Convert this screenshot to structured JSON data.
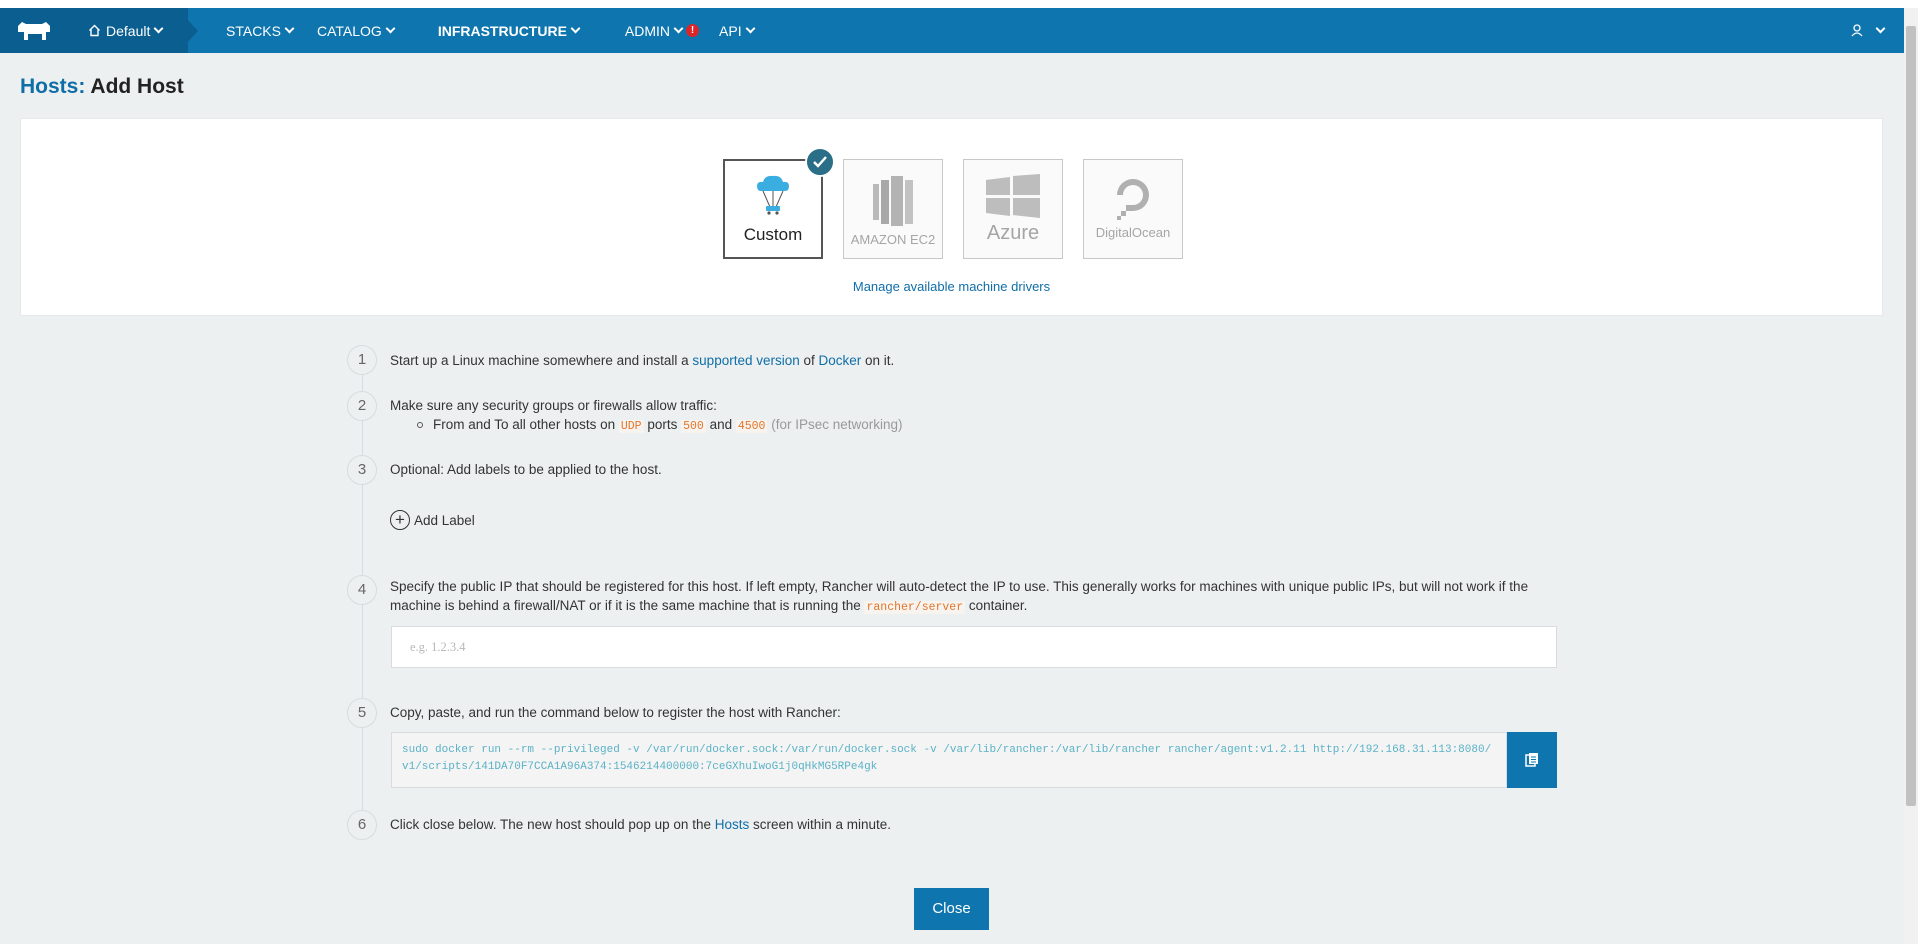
{
  "nav": {
    "environment": "Default",
    "items": [
      "STACKS",
      "CATALOG",
      "INFRASTRUCTURE",
      "ADMIN",
      "API"
    ],
    "admin_alert": "!"
  },
  "page": {
    "title_section": "Hosts:",
    "title_rest": " Add Host"
  },
  "drivers": {
    "items": [
      {
        "label": "Custom",
        "selected": true
      },
      {
        "label": "AMAZON EC2",
        "selected": false
      },
      {
        "label": "Azure",
        "selected": false
      },
      {
        "label": "DigitalOcean",
        "selected": false
      }
    ],
    "manage_link": "Manage available machine drivers"
  },
  "steps": {
    "s1": {
      "num": "1",
      "pre": "Start up a Linux machine somewhere and install a ",
      "link1": "supported version",
      "mid": " of ",
      "link2": "Docker",
      "post": " on it."
    },
    "s2": {
      "num": "2",
      "text": "Make sure any security groups or firewalls allow traffic:",
      "b_pre": "From and To all other hosts on ",
      "udp": "UDP",
      "ports": " ports ",
      "p1": "500",
      "and": " and ",
      "p2": "4500",
      "note": " (for IPsec networking)"
    },
    "s3": {
      "num": "3",
      "text": "Optional: Add labels to be applied to the host.",
      "add_label": "Add Label"
    },
    "s4": {
      "num": "4",
      "pre": "Specify the public IP that should be registered for this host. If left empty, Rancher will auto-detect the IP to use. This generally works for machines with unique public IPs, but will not work if the machine is behind a firewall/NAT or if it is the same machine that is running the ",
      "code": "rancher/server",
      "post": " container.",
      "placeholder": "e.g. 1.2.3.4"
    },
    "s5": {
      "num": "5",
      "text": "Copy, paste, and run the command below to register the host with Rancher:",
      "command": "sudo docker run --rm --privileged -v /var/run/docker.sock:/var/run/docker.sock -v /var/lib/rancher:/var/lib/rancher rancher/agent:v1.2.11 http://192.168.31.113:8080/v1/scripts/141DA70F7CCA1A96A374:1546214400000:7ceGXhuIwoG1j0qHkMG5RPe4gk"
    },
    "s6": {
      "num": "6",
      "pre": "Click close below. The new host should pop up on the ",
      "link": "Hosts",
      "post": " screen within a minute."
    }
  },
  "close_label": "Close",
  "colors": {
    "brand": "#0f75ae",
    "check": "#2a6f87",
    "code": "#e3752c"
  }
}
